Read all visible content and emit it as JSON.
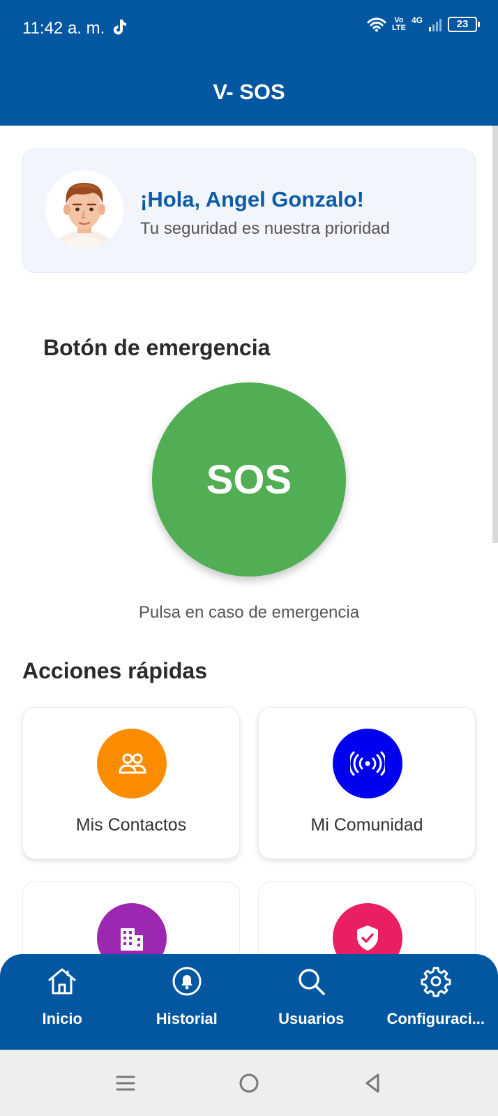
{
  "status_bar": {
    "time": "11:42 a. m.",
    "volte_top": "Vo",
    "volte_bottom": "LTE",
    "network": "4G",
    "battery": "23"
  },
  "app_bar": {
    "title": "V- SOS"
  },
  "greeting": {
    "title": "¡Hola, Angel Gonzalo!",
    "subtitle": "Tu seguridad es nuestra prioridad"
  },
  "emergency": {
    "heading": "Botón de emergencia",
    "button_label": "SOS",
    "hint": "Pulsa en caso de emergencia"
  },
  "quick_actions": {
    "heading": "Acciones rápidas",
    "items": [
      {
        "label": "Mis Contactos",
        "icon": "contacts-icon",
        "color": "#fb8c00"
      },
      {
        "label": "Mi Comunidad",
        "icon": "broadcast-icon",
        "color": "#0000f0"
      },
      {
        "label": "",
        "icon": "building-icon",
        "color": "#9c27b0"
      },
      {
        "label": "",
        "icon": "shield-check-icon",
        "color": "#e91e63"
      }
    ]
  },
  "bottom_nav": {
    "items": [
      {
        "label": "Inicio",
        "icon": "home-icon"
      },
      {
        "label": "Historial",
        "icon": "bell-icon"
      },
      {
        "label": "Usuarios",
        "icon": "search-icon"
      },
      {
        "label": "Configuraci...",
        "icon": "gear-icon"
      }
    ]
  },
  "colors": {
    "primary": "#0356a0",
    "sos_green": "#52ae54",
    "greeting_blue": "#0b5ba8"
  }
}
